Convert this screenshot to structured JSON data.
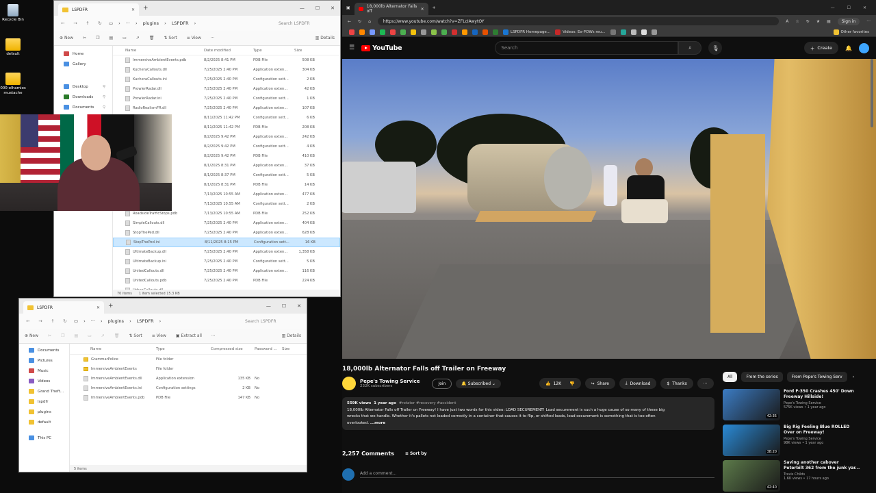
{
  "desktop": {
    "icons": [
      {
        "label": "Recycle Bin"
      },
      {
        "label": "default"
      },
      {
        "label": "000-elhamios mustache"
      }
    ]
  },
  "explorer1": {
    "tab_title": "LSPDFR",
    "path": [
      "plugins",
      "LSPDFR"
    ],
    "search_placeholder": "Search LSPDFR",
    "toolbar": {
      "new": "New",
      "sort": "Sort",
      "view": "View",
      "details": "Details"
    },
    "nav": [
      "Home",
      "Gallery",
      "Desktop",
      "Downloads",
      "Documents"
    ],
    "columns": {
      "name": "Name",
      "date": "Date modified",
      "type": "Type",
      "size": "Size"
    },
    "files": [
      {
        "name": "ImmersiveAmbientEvents.pdb",
        "date": "8/2/2025 8:41 PM",
        "type": "PDB File",
        "size": "508 KB"
      },
      {
        "name": "KucheraCallouts.dll",
        "date": "7/25/2025 2:40 PM",
        "type": "Application exten...",
        "size": "304 KB"
      },
      {
        "name": "KucheraCallouts.ini",
        "date": "7/25/2025 2:40 PM",
        "type": "Configuration sett...",
        "size": "2 KB"
      },
      {
        "name": "ProwlerRadar.dll",
        "date": "7/25/2025 2:40 PM",
        "type": "Application exten...",
        "size": "42 KB"
      },
      {
        "name": "ProwlerRadar.ini",
        "date": "7/25/2025 2:40 PM",
        "type": "Configuration sett...",
        "size": "1 KB"
      },
      {
        "name": "RadioRealismFR.dll",
        "date": "7/25/2025 2:40 PM",
        "type": "Application exten...",
        "size": "107 KB"
      },
      {
        "name": "",
        "date": "8/11/2025 11:42 PM",
        "type": "Configuration sett...",
        "size": "6 KB"
      },
      {
        "name": "",
        "date": "8/11/2025 11:42 PM",
        "type": "PDB File",
        "size": "208 KB"
      },
      {
        "name": "",
        "date": "8/2/2025 9:42 PM",
        "type": "Application exten...",
        "size": "242 KB"
      },
      {
        "name": "",
        "date": "8/2/2025 9:42 PM",
        "type": "Configuration sett...",
        "size": "4 KB"
      },
      {
        "name": "",
        "date": "8/2/2025 9:42 PM",
        "type": "PDB File",
        "size": "410 KB"
      },
      {
        "name": "",
        "date": "8/1/2025 8:31 PM",
        "type": "Application exten...",
        "size": "37 KB"
      },
      {
        "name": "",
        "date": "8/1/2025 8:37 PM",
        "type": "Configuration sett...",
        "size": "5 KB"
      },
      {
        "name": "",
        "date": "8/1/2025 8:31 PM",
        "type": "PDB File",
        "size": "14 KB"
      },
      {
        "name": "",
        "date": "7/13/2025 10:55 AM",
        "type": "Application exten...",
        "size": "477 KB"
      },
      {
        "name": "",
        "date": "7/13/2025 10:55 AM",
        "type": "Configuration sett...",
        "size": "2 KB"
      },
      {
        "name": "RoadsideTrafficStops.pdb",
        "date": "7/13/2025 10:55 AM",
        "type": "PDB File",
        "size": "252 KB"
      },
      {
        "name": "SimpleCallouts.dll",
        "date": "7/25/2025 2:40 PM",
        "type": "Application exten...",
        "size": "404 KB"
      },
      {
        "name": "StopThePed.dll",
        "date": "7/25/2025 2:40 PM",
        "type": "Application exten...",
        "size": "628 KB"
      },
      {
        "name": "StopThePed.ini",
        "date": "8/11/2025 8:15 PM",
        "type": "Configuration sett...",
        "size": "16 KB"
      },
      {
        "name": "UltimateBackup.dll",
        "date": "7/25/2025 2:40 PM",
        "type": "Application exten...",
        "size": "1,358 KB"
      },
      {
        "name": "UltimateBackup.ini",
        "date": "7/25/2025 2:40 PM",
        "type": "Configuration sett...",
        "size": "5 KB"
      },
      {
        "name": "UnitedCallouts.dll",
        "date": "7/25/2025 2:40 PM",
        "type": "Application exten...",
        "size": "116 KB"
      },
      {
        "name": "UnitedCallouts.pdb",
        "date": "7/25/2025 2:40 PM",
        "type": "PDB File",
        "size": "224 KB"
      },
      {
        "name": "UrbanCallouts.dll",
        "date": "",
        "type": "",
        "size": ""
      }
    ],
    "status": {
      "count": "70 items",
      "selected": "1 item selected  15.3 KB"
    }
  },
  "explorer2": {
    "tab_title": "LSPDFR",
    "path": [
      "plugins",
      "LSPDFR"
    ],
    "search_placeholder": "Search LSPDFR",
    "toolbar": {
      "new": "New",
      "sort": "Sort",
      "view": "View",
      "extract": "Extract all",
      "details": "Details"
    },
    "nav": [
      "Documents",
      "Pictures",
      "Music",
      "Videos",
      "Grand Theft...",
      "lspdfr",
      "plugins",
      "default",
      "This PC"
    ],
    "columns": {
      "name": "Name",
      "type": "Type",
      "compressed": "Compressed size",
      "password": "Password ...",
      "size": "Size"
    },
    "files": [
      {
        "name": "GrammarPolice",
        "type": "File folder",
        "compressed": "",
        "password": "",
        "folder": true
      },
      {
        "name": "ImmersiveAmbientEvents",
        "type": "File folder",
        "compressed": "",
        "password": "",
        "folder": true
      },
      {
        "name": "ImmersiveAmbientEvents.dll",
        "type": "Application extension",
        "compressed": "135 KB",
        "password": "No",
        "folder": false
      },
      {
        "name": "ImmersiveAmbientEvents.ini",
        "type": "Configuration settings",
        "compressed": "2 KB",
        "password": "No",
        "folder": false
      },
      {
        "name": "ImmersiveAmbientEvents.pdb",
        "type": "PDB File",
        "compressed": "147 KB",
        "password": "No",
        "folder": false
      }
    ],
    "status": {
      "count": "5 items"
    }
  },
  "browser": {
    "tab_title": "18,000lb Alternator Falls off",
    "url": "https://www.youtube.com/watch?v=ZFLcIAwytOY",
    "signin": "Sign in",
    "bookmarks": {
      "lspdfr": "LSPDFR Homepage...",
      "videos": "Videos: Ex-POWs reu...",
      "other": "Other favorites"
    }
  },
  "youtube": {
    "logo": "YouTube",
    "search_placeholder": "Search",
    "create": "Create",
    "video": {
      "title": "18,000lb Alternator Falls off Trailer on Freeway",
      "channel": "Pepe's Towing Service",
      "subscribers": "232K subscribers",
      "join": "Join",
      "subscribed": "Subscribed",
      "likes": "12K",
      "share": "Share",
      "download": "Download",
      "thanks": "Thanks",
      "views": "559K views",
      "age": "1 year ago",
      "tags": "#rotator #recovery #accident",
      "description_1": "18,000lb Alternator Falls off Trailer on Freeway! I have just two words for this video: LOAD SECUREMENT! Load securement is such a huge cause of so many of these big",
      "description_2": "wrecks that we handle. Whether it's pallets not loaded correctly in a container that causes it to flip, or shifted loads, load securement is something that is too often",
      "description_3": "overlooked.",
      "more": "...more"
    },
    "comments": {
      "count": "2,257 Comments",
      "sort": "Sort by",
      "placeholder": "Add a comment..."
    },
    "chips": [
      "All",
      "From the series",
      "From Pepe's Towing Serv"
    ],
    "recommendations": [
      {
        "title_1": "Ford F-350 Crashes 450' Down",
        "title_2": "Freeway Hillside!",
        "channel": "Pepe's Towing Service",
        "meta": "575K views • 1 year ago",
        "duration": "42:35",
        "color": "#3b7cc4"
      },
      {
        "title_1": "Big Rig Feeling Blue ROLLED",
        "title_2": "Over on Freeway!",
        "channel": "Pepe's Towing Service",
        "meta": "98K views • 1 year ago",
        "duration": "38:20",
        "color": "#2a8ad6"
      },
      {
        "title_1": "Saving another cabover",
        "title_2": "Peterbilt 362 from the junk yar...",
        "channel": "Travis Childs",
        "meta": "1.6K views • 17 hours ago",
        "duration": "42:40",
        "color": "#5c7a4a"
      }
    ]
  }
}
